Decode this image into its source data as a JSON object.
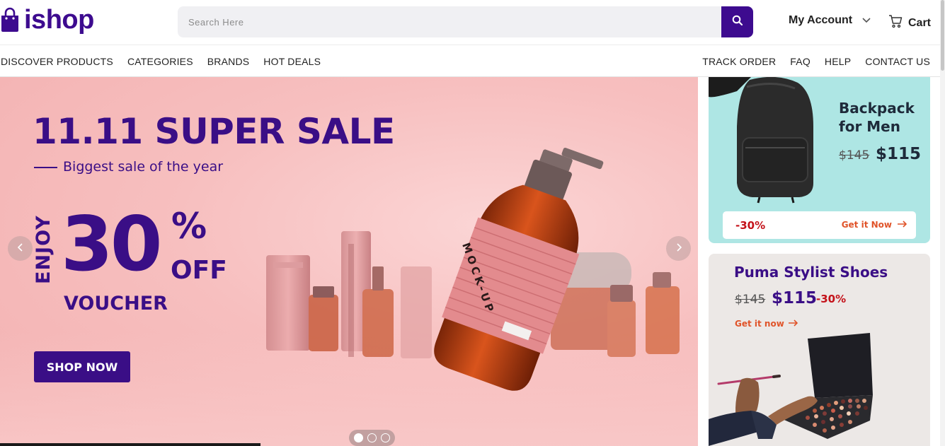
{
  "header": {
    "logo_text": "ishop",
    "search_placeholder": "Search Here",
    "account_label": "My Account",
    "cart_label": "Cart"
  },
  "nav": {
    "left": [
      "DISCOVER PRODUCTS",
      "CATEGORIES",
      "BRANDS",
      "HOT DEALS"
    ],
    "right": [
      "TRACK ORDER",
      "FAQ",
      "HELP",
      "CONTACT US"
    ]
  },
  "hero": {
    "title": "11.11 SUPER SALE",
    "subtitle": "Biggest sale of the year",
    "enjoy": "ENJOY",
    "amount": "30",
    "percent_sign": "%",
    "off": "OFF",
    "voucher": "VOUCHER",
    "cta": "SHOP NOW",
    "bottle_label": "MOCK-UP",
    "slides": 3,
    "active_slide": 1
  },
  "side_cards": [
    {
      "title": "Backpack for Men",
      "old_price": "$145",
      "new_price": "$115",
      "discount": "-30%",
      "cta": "Get it Now",
      "background": "#aee6e4"
    },
    {
      "title": "Puma Stylist Shoes",
      "old_price": "$145",
      "new_price": "$115",
      "discount": "-30%",
      "cta": "Get it now",
      "background": "#ece8e6"
    }
  ],
  "colors": {
    "brand": "#3d0b8f",
    "discount": "#c4121a",
    "cta": "#e0542a"
  },
  "icons": {
    "logo": "shopping-bag-icon",
    "search": "search-icon",
    "account": "chevron-down-icon",
    "cart": "cart-icon",
    "prev": "chevron-left-icon",
    "next": "chevron-right-icon",
    "cta_arrow": "arrow-right-icon"
  }
}
